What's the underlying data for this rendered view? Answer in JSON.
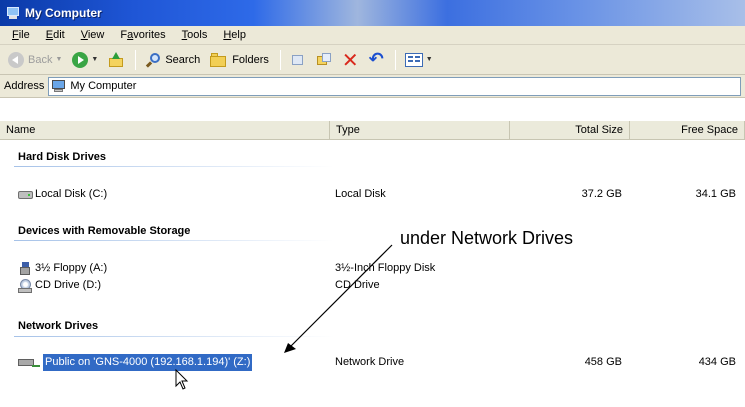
{
  "window": {
    "title": "My Computer"
  },
  "menu": [
    "File",
    "Edit",
    "View",
    "Favorites",
    "Tools",
    "Help"
  ],
  "menu_mnemonics": [
    "F",
    "E",
    "V",
    "a",
    "T",
    "H"
  ],
  "toolbar": {
    "back_label": "Back",
    "search_label": "Search",
    "folders_label": "Folders"
  },
  "address": {
    "label": "Address",
    "value": "My Computer"
  },
  "columns": {
    "name": "Name",
    "type": "Type",
    "total": "Total Size",
    "free": "Free Space"
  },
  "groups": {
    "hard_disk": "Hard Disk Drives",
    "removable": "Devices with Removable Storage",
    "network": "Network Drives"
  },
  "rows": {
    "local_disk": {
      "name": "Local Disk (C:)",
      "type": "Local Disk",
      "total": "37.2 GB",
      "free": "34.1 GB"
    },
    "floppy": {
      "name": "3½ Floppy (A:)",
      "type": "3½-Inch Floppy Disk"
    },
    "cd": {
      "name": "CD Drive (D:)",
      "type": "CD Drive"
    },
    "network_drive": {
      "name": "Public on 'GNS-4000 (192.168.1.194)' (Z:)",
      "type": "Network Drive",
      "total": "458 GB",
      "free": "434 GB"
    }
  },
  "annotation": "under Network Drives",
  "icons": [
    "computer-icon",
    "back-icon",
    "forward-icon",
    "up-folder-icon",
    "search-icon",
    "folders-icon",
    "move-to-icon",
    "copy-to-icon",
    "delete-icon",
    "undo-icon",
    "views-icon",
    "hard-disk-icon",
    "floppy-icon",
    "cd-drive-icon",
    "network-drive-icon",
    "mouse-cursor-icon"
  ],
  "colors": {
    "title_bar": "#1f56d6",
    "selection": "#316ac5",
    "chrome": "#ece9d8",
    "delete_red": "#d9291c"
  }
}
